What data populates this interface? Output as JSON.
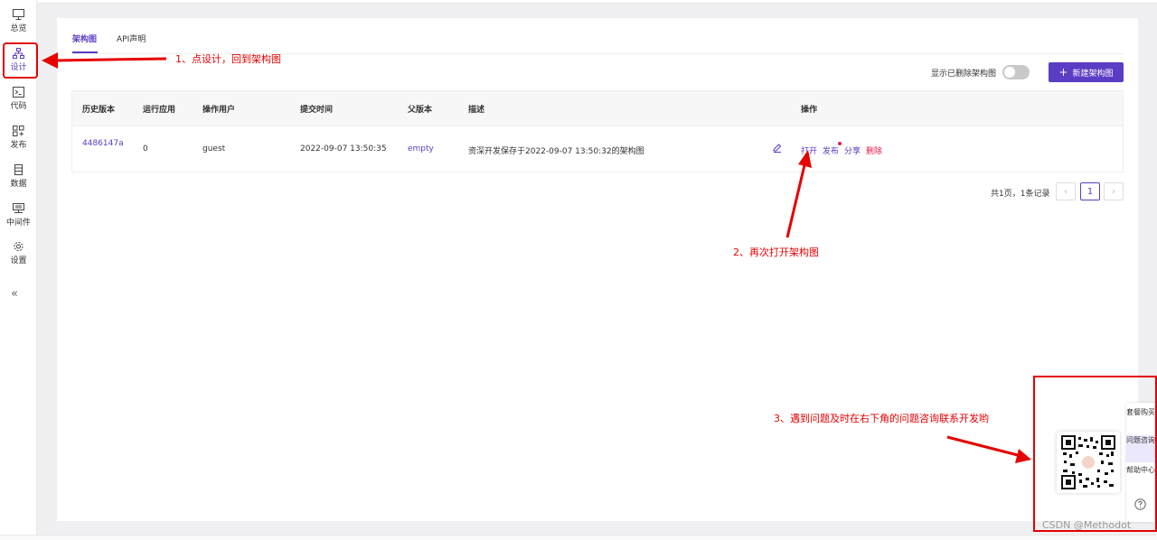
{
  "sidebar": {
    "items": [
      {
        "label": "总览",
        "icon": "monitor-icon"
      },
      {
        "label": "设计",
        "icon": "sitemap-icon"
      },
      {
        "label": "代码",
        "icon": "terminal-icon"
      },
      {
        "label": "发布",
        "icon": "deploy-icon"
      },
      {
        "label": "数据",
        "icon": "database-icon"
      },
      {
        "label": "中间件",
        "icon": "middleware-icon"
      },
      {
        "label": "设置",
        "icon": "gear-icon"
      }
    ],
    "collapse_label": "«"
  },
  "tabs": [
    {
      "label": "架构图"
    },
    {
      "label": "API声明"
    }
  ],
  "toolbar": {
    "toggle_label": "显示已删除架构图",
    "new_button_label": "新建架构图"
  },
  "table": {
    "headers": [
      "历史版本",
      "运行应用",
      "操作用户",
      "提交时间",
      "父版本",
      "描述",
      "操作"
    ],
    "rows": [
      {
        "version": "4486147a",
        "running": "0",
        "user": "guest",
        "time": "2022-09-07 13:50:35",
        "parent": "empty",
        "description": "资深开发保存于2022-09-07 13:50:32的架构图",
        "ops": [
          "打开",
          "发布",
          "分享",
          "删除"
        ]
      }
    ]
  },
  "pagination": {
    "summary": "共1页，1条记录",
    "prev": "‹",
    "current": "1",
    "next": "›"
  },
  "annotations": {
    "step1": "1、点设计，回到架构图",
    "step2": "2、再次打开架构图",
    "step3": "3、遇到问题及时在右下角的问题咨询联系开发哟"
  },
  "float_panel": {
    "items": [
      "套餐购买",
      "问题咨询",
      "帮助中心"
    ],
    "help_icon": "question-circle-icon"
  },
  "watermark": "CSDN @Methodot",
  "colors": {
    "accent": "#5b3cc4",
    "danger": "#e6194b",
    "annotation": "#e60000"
  }
}
